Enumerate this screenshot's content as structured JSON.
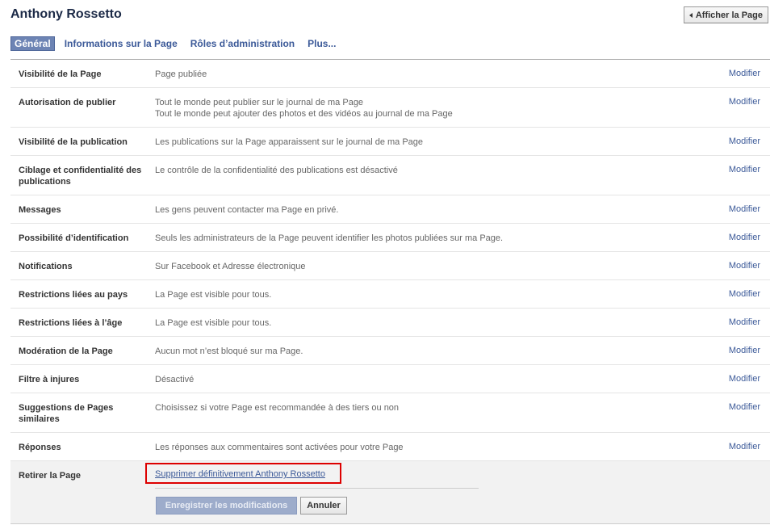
{
  "header": {
    "title": "Anthony Rossetto",
    "view_page_label": "Afficher la Page"
  },
  "tabs": [
    {
      "label": "Général",
      "active": true
    },
    {
      "label": "Informations sur la Page",
      "active": false
    },
    {
      "label": "Rôles d’administration",
      "active": false
    },
    {
      "label": "Plus...",
      "active": false
    }
  ],
  "edit_label": "Modifier",
  "rows": [
    {
      "label": "Visibilité de la Page",
      "value": "Page publiée"
    },
    {
      "label": "Autorisation de publier",
      "value": "Tout le monde peut publier sur le journal de ma Page",
      "value2": "Tout le monde peut ajouter des photos et des vidéos au journal de ma Page"
    },
    {
      "label": "Visibilité de la publication",
      "value": "Les publications sur la Page apparaissent sur le journal de ma Page"
    },
    {
      "label": "Ciblage et confidentialité des publications",
      "value": "Le contrôle de la confidentialité des publications est désactivé"
    },
    {
      "label": "Messages",
      "value": "Les gens peuvent contacter ma Page en privé."
    },
    {
      "label": "Possibilité d’identification",
      "value": "Seuls les administrateurs de la Page peuvent identifier les photos publiées sur ma Page."
    },
    {
      "label": "Notifications",
      "value": "Sur Facebook et Adresse électronique"
    },
    {
      "label": "Restrictions liées au pays",
      "value": "La Page est visible pour tous."
    },
    {
      "label": "Restrictions liées à l’âge",
      "value": "La Page est visible pour tous."
    },
    {
      "label": "Modération de la Page",
      "value": "Aucun mot n’est bloqué sur ma Page."
    },
    {
      "label": "Filtre à injures",
      "value": "Désactivé"
    },
    {
      "label": "Suggestions de Pages similaires",
      "value": "Choisissez si votre Page est recommandée à des tiers ou non"
    },
    {
      "label": "Réponses",
      "value": "Les réponses aux commentaires sont activées pour votre Page"
    }
  ],
  "remove": {
    "label": "Retirer la Page",
    "delete_link": "Supprimer définitivement Anthony Rossetto",
    "save_label": "Enregistrer les modifications",
    "cancel_label": "Annuler"
  },
  "colors": {
    "link": "#3b5998",
    "highlight_box": "#dd0000",
    "active_tab": "#6d84b4"
  }
}
